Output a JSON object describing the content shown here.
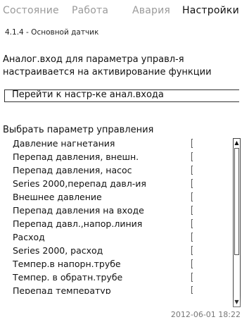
{
  "tabs": [
    {
      "label": "Состояние",
      "active": false
    },
    {
      "label": "Работа",
      "active": false
    },
    {
      "label": "Авария",
      "active": false
    },
    {
      "label": "Настройки",
      "active": true
    }
  ],
  "breadcrumb": "4.1.4 - Основной датчик",
  "info": {
    "line1": "Аналог.вход для параметра управл-я",
    "line2": "настраивается на активирование функции"
  },
  "goto_link": "Перейти к настр-ке анал.входа",
  "section_title": "Выбрать параметр управления",
  "params": [
    {
      "label": "Давление нагнетания",
      "checked": true,
      "mark": "✓"
    },
    {
      "label": "Перепад давления, внешн.",
      "checked": false,
      "mark": ""
    },
    {
      "label": "Перепад давления, насос",
      "checked": false,
      "mark": ""
    },
    {
      "label": "Series 2000,перепад давл-ия",
      "checked": false,
      "mark": ""
    },
    {
      "label": "Внешнее давление",
      "checked": false,
      "mark": ""
    },
    {
      "label": "Перепад давления на входе",
      "checked": false,
      "mark": ""
    },
    {
      "label": "Перепад давл.,напор.линия",
      "checked": false,
      "mark": ""
    },
    {
      "label": "Расход",
      "checked": false,
      "mark": ""
    },
    {
      "label": "Series 2000, расход",
      "checked": false,
      "mark": ""
    },
    {
      "label": "Темпер.в напорн.трубе",
      "checked": false,
      "mark": ""
    },
    {
      "label": "Темпер. в обратн.трубе",
      "checked": false,
      "mark": ""
    },
    {
      "label": "Перепад температур",
      "checked": false,
      "mark": ""
    }
  ],
  "scrollbar": {
    "up": "▲",
    "down": "▼"
  },
  "datetime": "2012-06-01 18:22"
}
